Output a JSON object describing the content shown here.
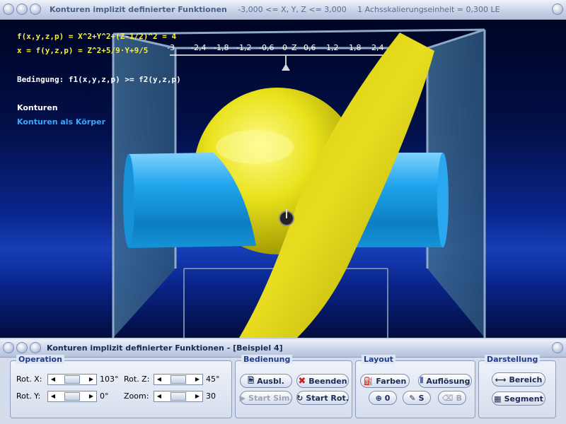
{
  "top_window": {
    "title": "Konturen implizit definierter Funktionen",
    "range": "-3,000 <= X, Y, Z <= 3,000",
    "scale": "1 Achsskalierungseinheit = 0,300 LE"
  },
  "hud": {
    "function1": "f(x,y,z,p) = X^2+Y^2+(Z-1/2)^2 = 4",
    "function2": "x = f(y,z,p) = Z^2+5/9·Y+9/5",
    "condition": "Bedingung: f1(x,y,z,p) >= f2(y,z,p)",
    "contours": "Konturen",
    "contours_as_body": "Konturen als Körper"
  },
  "axis": {
    "ticks": [
      "-3",
      "-2,4",
      "-1,8",
      "-1,2",
      "-0,6",
      "0",
      "0,6",
      "1,2",
      "1,8",
      "2,4"
    ],
    "label": "Z"
  },
  "colors": {
    "function1": "#f3ef3a",
    "function2": "#f3ef3a",
    "condition": "#ffffff",
    "contours": "#ffffff",
    "contours_as_body": "#3aa7ff",
    "sphere": "#e8e020",
    "plane": "#d7cc10",
    "cylinder": "#1fa6ea"
  },
  "bottom_window": {
    "title": "Konturen implizit definierter Funktionen - [Beispiel 4]"
  },
  "operation": {
    "legend": "Operation",
    "rot_x_label": "Rot. X:",
    "rot_x_value": "103°",
    "rot_y_label": "Rot. Y:",
    "rot_y_value": "0°",
    "rot_z_label": "Rot. Z:",
    "rot_z_value": "45°",
    "zoom_label": "Zoom:",
    "zoom_value": "30"
  },
  "bedienung": {
    "legend": "Bedienung",
    "ausbl": "Ausbl.",
    "beenden": "Beenden",
    "start_sim": "Start Sim.",
    "start_rot": "Start Rot."
  },
  "layout": {
    "legend": "Layout",
    "farben": "Farben",
    "aufloesung": "Auflösung",
    "zero": "0",
    "s": "S",
    "b": "B"
  },
  "darstellung": {
    "legend": "Darstellung",
    "bereich": "Bereich",
    "segment": "Segment"
  }
}
